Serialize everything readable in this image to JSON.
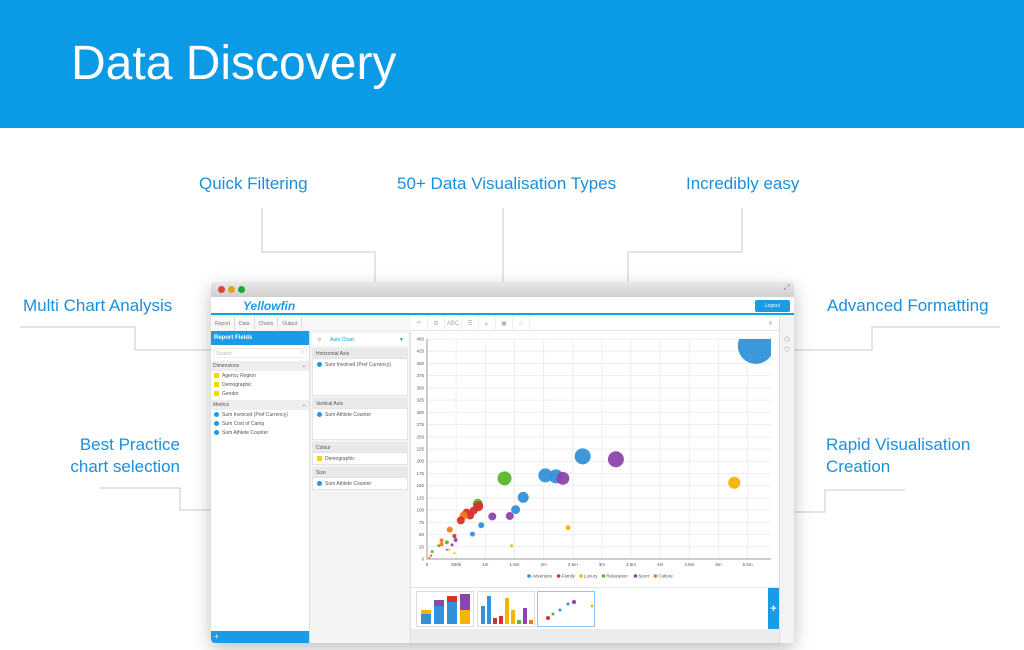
{
  "hero": {
    "title": "Data Discovery"
  },
  "callouts": {
    "quick_filtering": "Quick Filtering",
    "types": "50+ Data Visualisation Types",
    "easy": "Incredibly easy",
    "multi": "Multi Chart Analysis",
    "best_1": "Best Practice",
    "best_2": "chart selection",
    "advanced": "Advanced Formatting",
    "rapid_1": "Rapid Visualisation",
    "rapid_2": "Creation"
  },
  "app": {
    "logo": "Yellowfin",
    "logout": "Logout",
    "tabs": [
      "Report",
      "Data",
      "Charts",
      "Output"
    ],
    "report_fields": "Report Fields",
    "search_placeholder": "Search",
    "dimensions_label": "Dimensions",
    "dimensions": [
      "Agency Region",
      "Demographic",
      "Gender"
    ],
    "metrics_label": "Metrics",
    "metrics": [
      "Sum Invoiced (Pref Currency)",
      "Sum Cost of Camp",
      "Sum Athlete Counter"
    ],
    "auto_chart": "Auto Chart",
    "horizontal_axis": "Horizontal Axis",
    "horizontal_value": "Sum Invoiced (Pref Currency)",
    "vertical_axis": "Vertical Axis",
    "vertical_value": "Sum Athlete Counter",
    "colour": "Colour",
    "colour_value": "Demographic",
    "size": "Size",
    "size_value": "Sum Athlete Counter",
    "add": "+"
  },
  "colors": {
    "accent": "#1a9be6",
    "Adventure": "#3391d9",
    "Family": "#d5322b",
    "Luxury": "#f5b400",
    "Relaxation": "#5cb52a",
    "Sport": "#8e44ad",
    "Culture": "#f07a1a"
  },
  "chart_data": {
    "type": "scatter",
    "xlim": [
      0,
      5.9
    ],
    "ylim": [
      0,
      450
    ],
    "xticks": [
      {
        "v": 0,
        "l": "0"
      },
      {
        "v": 0.5,
        "l": "500k"
      },
      {
        "v": 1,
        "l": "1m"
      },
      {
        "v": 1.5,
        "l": "1.5m"
      },
      {
        "v": 2,
        "l": "2m"
      },
      {
        "v": 2.5,
        "l": "2.5m"
      },
      {
        "v": 3,
        "l": "3m"
      },
      {
        "v": 3.5,
        "l": "3.5m"
      },
      {
        "v": 4,
        "l": "4m"
      },
      {
        "v": 4.5,
        "l": "4.5m"
      },
      {
        "v": 5,
        "l": "5m"
      },
      {
        "v": 5.5,
        "l": "5.5m"
      }
    ],
    "yticks": [
      "0",
      "25",
      "50",
      "75",
      "100",
      "125",
      "150",
      "175",
      "200",
      "225",
      "250",
      "275",
      "300",
      "325",
      "350",
      "375",
      "400",
      "425",
      "450"
    ],
    "legend": [
      "Adventure",
      "Family",
      "Luxury",
      "Relaxation",
      "Sport",
      "Culture"
    ],
    "legend_position": "bottom",
    "grid": true,
    "points": [
      {
        "s": "Adventure",
        "x": 5.64,
        "y": 436,
        "size": 18
      },
      {
        "s": "Adventure",
        "x": 2.67,
        "y": 210,
        "size": 8
      },
      {
        "s": "Sport",
        "x": 3.24,
        "y": 204,
        "size": 8
      },
      {
        "s": "Relaxation",
        "x": 1.33,
        "y": 165,
        "size": 7
      },
      {
        "s": "Adventure",
        "x": 2.03,
        "y": 171,
        "size": 7
      },
      {
        "s": "Adventure",
        "x": 2.21,
        "y": 169,
        "size": 7
      },
      {
        "s": "Sport",
        "x": 2.33,
        "y": 165,
        "size": 6.5
      },
      {
        "s": "Luxury",
        "x": 5.27,
        "y": 156,
        "size": 6
      },
      {
        "s": "Adventure",
        "x": 1.65,
        "y": 126,
        "size": 5.5
      },
      {
        "s": "Adventure",
        "x": 1.52,
        "y": 101,
        "size": 4.5
      },
      {
        "s": "Sport",
        "x": 1.42,
        "y": 88,
        "size": 4
      },
      {
        "s": "Sport",
        "x": 1.12,
        "y": 87,
        "size": 4
      },
      {
        "s": "Adventure",
        "x": 0.93,
        "y": 69,
        "size": 3
      },
      {
        "s": "Adventure",
        "x": 0.78,
        "y": 51,
        "size": 2.5
      },
      {
        "s": "Luxury",
        "x": 2.42,
        "y": 64,
        "size": 2.5
      },
      {
        "s": "Luxury",
        "x": 1.45,
        "y": 27,
        "size": 1.5
      },
      {
        "s": "Relaxation",
        "x": 0.87,
        "y": 113,
        "size": 5
      },
      {
        "s": "Family",
        "x": 0.88,
        "y": 108,
        "size": 5
      },
      {
        "s": "Family",
        "x": 0.8,
        "y": 99,
        "size": 4
      },
      {
        "s": "Family",
        "x": 0.74,
        "y": 89,
        "size": 4
      },
      {
        "s": "Family",
        "x": 0.68,
        "y": 95,
        "size": 4
      },
      {
        "s": "Culture",
        "x": 0.63,
        "y": 89,
        "size": 4
      },
      {
        "s": "Family",
        "x": 0.58,
        "y": 79,
        "size": 4
      },
      {
        "s": "Culture",
        "x": 0.39,
        "y": 60,
        "size": 3
      },
      {
        "s": "Family",
        "x": 0.47,
        "y": 47,
        "size": 2
      },
      {
        "s": "Sport",
        "x": 0.49,
        "y": 39,
        "size": 2
      },
      {
        "s": "Sport",
        "x": 0.43,
        "y": 29,
        "size": 1.5
      },
      {
        "s": "Relaxation",
        "x": 0.34,
        "y": 34,
        "size": 2
      },
      {
        "s": "Culture",
        "x": 0.25,
        "y": 38,
        "size": 2
      },
      {
        "s": "Culture",
        "x": 0.25,
        "y": 30,
        "size": 2
      },
      {
        "s": "Relaxation",
        "x": 0.2,
        "y": 27,
        "size": 1.5
      },
      {
        "s": "Sport",
        "x": 0.34,
        "y": 19,
        "size": 1
      },
      {
        "s": "Luxury",
        "x": 0.38,
        "y": 19,
        "size": 1
      },
      {
        "s": "Luxury",
        "x": 0.47,
        "y": 12,
        "size": 1
      },
      {
        "s": "Relaxation",
        "x": 0.09,
        "y": 15,
        "size": 1.5
      },
      {
        "s": "Family",
        "x": 0.07,
        "y": 7,
        "size": 1
      },
      {
        "s": "Culture",
        "x": 0.04,
        "y": 3,
        "size": 1
      }
    ]
  }
}
